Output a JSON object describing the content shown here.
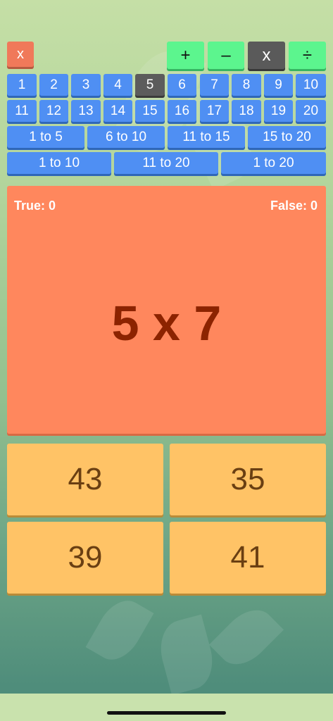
{
  "close_button": {
    "label": "x"
  },
  "operations": [
    {
      "label": "+",
      "selected": false
    },
    {
      "label": "–",
      "selected": false
    },
    {
      "label": "x",
      "selected": true
    },
    {
      "label": "÷",
      "selected": false
    }
  ],
  "numbers": [
    "1",
    "2",
    "3",
    "4",
    "5",
    "6",
    "7",
    "8",
    "9",
    "10",
    "11",
    "12",
    "13",
    "14",
    "15",
    "16",
    "17",
    "18",
    "19",
    "20"
  ],
  "selected_number": "5",
  "ranges_row1": [
    "1 to 5",
    "6 to 10",
    "11 to 15",
    "15 to 20"
  ],
  "ranges_row2": [
    "1 to 10",
    "11 to 20",
    "1 to 20"
  ],
  "score": {
    "true_label": "True: 0",
    "false_label": "False: 0"
  },
  "question": "5 x 7",
  "answers": [
    "43",
    "35",
    "39",
    "41"
  ],
  "colors": {
    "number_button": "#4f8ff3",
    "selected_button": "#5c5c5c",
    "operation_button": "#5cf58e",
    "question_panel": "#ff875d",
    "answer_button": "#ffc366",
    "close_button": "#f0795a"
  }
}
